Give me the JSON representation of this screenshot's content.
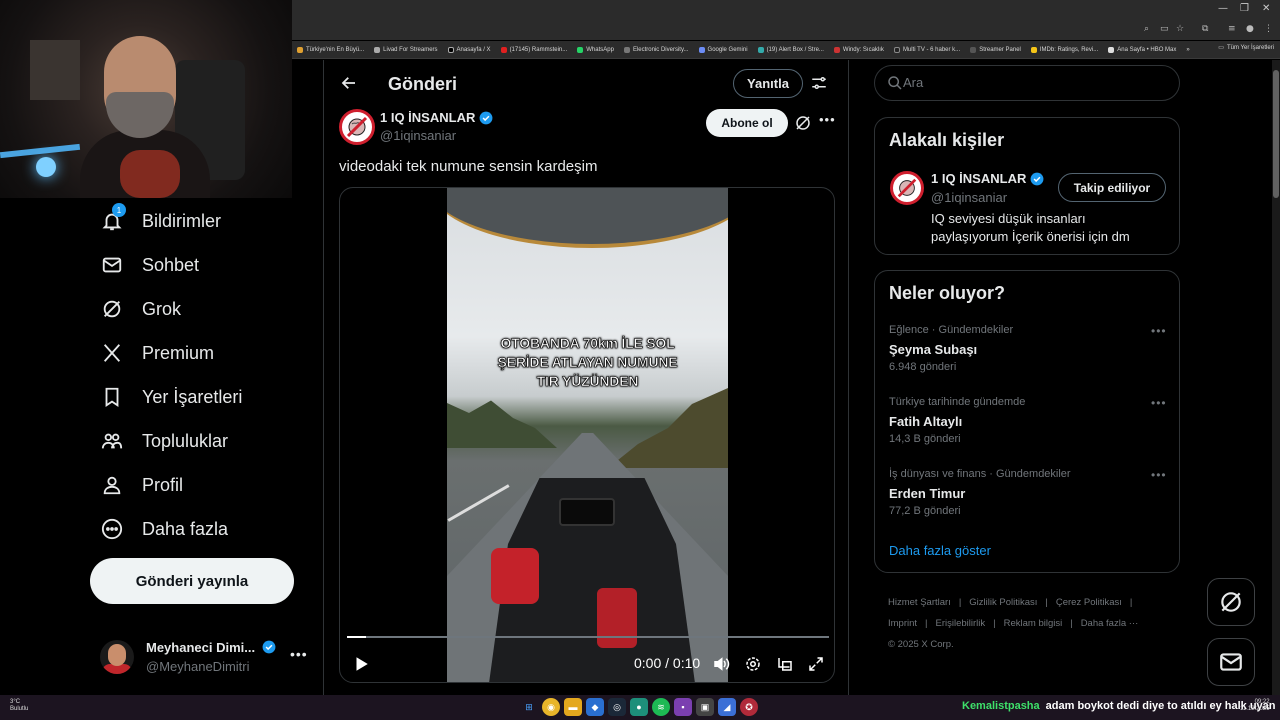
{
  "browser": {
    "bookmarks": [
      "Türkiye'nin En Büyü...",
      "Livad For Streamers",
      "Anasayfa / X",
      "(17145) Rammstein...",
      "WhatsApp",
      "Electronic Diversity...",
      "Google Gemini",
      "(19) Alert Box / Stre...",
      "Windy: Sıcaklık",
      "Multi TV - 6 haber k...",
      "Streamer Panel",
      "IMDb: Ratings, Revi...",
      "Ana Sayfa • HBO Max"
    ],
    "bookmarks_more": "»",
    "all_bookmarks": "Tüm Yer İşaretleri"
  },
  "nav": {
    "items": [
      {
        "label": "Bildirimler",
        "icon": "bell-icon",
        "badge": "1"
      },
      {
        "label": "Sohbet",
        "icon": "mail-icon"
      },
      {
        "label": "Grok",
        "icon": "grok-icon"
      },
      {
        "label": "Premium",
        "icon": "x-logo-icon"
      },
      {
        "label": "Yer İşaretleri",
        "icon": "bookmark-icon"
      },
      {
        "label": "Topluluklar",
        "icon": "people-icon"
      },
      {
        "label": "Profil",
        "icon": "person-icon"
      },
      {
        "label": "Daha fazla",
        "icon": "more-circle-icon"
      }
    ],
    "post_button": "Gönderi yayınla",
    "account": {
      "name": "Meyhaneci Dimi...",
      "handle": "@MeyhaneDimitri",
      "more": "•••"
    }
  },
  "post": {
    "header_title": "Gönderi",
    "reply_button": "Yanıtla",
    "author": {
      "name": "1 IQ İNSANLAR",
      "handle": "@1iqinsaniar",
      "verified": true
    },
    "subscribe_button": "Abone ol",
    "more": "•••",
    "text": "videodaki tek numune sensin kardeşim",
    "video": {
      "overlay_lines": [
        "OTOBANDA 70km İLE SOL",
        "ŞERİDE ATLAYAN NUMUNE",
        "TIR YÜZÜNDEN"
      ],
      "time": "0:00 / 0:10",
      "progress": 0.04
    }
  },
  "right": {
    "search_placeholder": "Ara",
    "related": {
      "title": "Alakalı kişiler",
      "name": "1 IQ İNSANLAR",
      "handle": "@1iqinsaniar",
      "follow_button": "Takip ediliyor",
      "bio": "IQ seviyesi düşük insanları paylaşıyorum İçerik önerisi için dm"
    },
    "trends": {
      "title": "Neler oluyor?",
      "items": [
        {
          "context": "Eğlence · Gündemdekiler",
          "name": "Şeyma Subaşı",
          "count": "6.948 gönderi"
        },
        {
          "context": "Türkiye tarihinde gündemde",
          "name": "Fatih Altaylı",
          "count": "14,3 B gönderi"
        },
        {
          "context": "İş dünyası ve finans · Gündemdekiler",
          "name": "Erden Timur",
          "count": "77,2 B gönderi"
        }
      ],
      "more_dots": "•••",
      "show_more": "Daha fazla göster"
    },
    "footer": [
      "Hizmet Şartları",
      "|",
      "Gizlilik Politikası",
      "|",
      "Çerez Politikası",
      "|",
      "Imprint",
      "|",
      "Erişilebilirlik",
      "|",
      "Reklam bilgisi",
      "|",
      "Daha fazla ···",
      "© 2025 X Corp."
    ]
  },
  "taskbar": {
    "weather_temp": "3°C",
    "weather_desc": "Bulutlu",
    "ticker_user": "Kemalistpasha",
    "ticker_msg": "adam boykot dedi diye to atıldı ey halk uyan",
    "clock_time": "09:22",
    "clock_date": "11.12.2025"
  },
  "colors": {
    "accent": "#1d9bf0",
    "background": "#000000",
    "border": "#2f3336",
    "muted": "#71767b",
    "ticker_user": "#3ee06a"
  }
}
